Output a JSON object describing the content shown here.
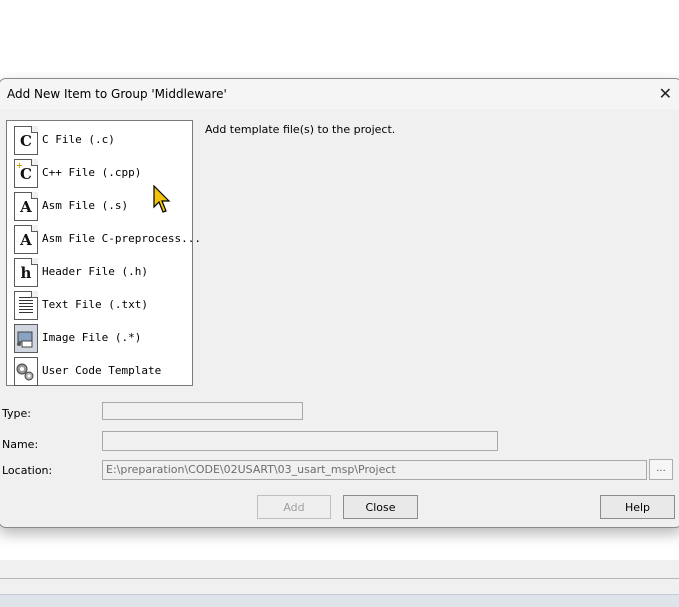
{
  "dialog": {
    "title": "Add New Item to Group 'Middleware'",
    "description": "Add template file(s) to the project.",
    "file_types": [
      {
        "label": "C File (.c)",
        "icon": "c-file-icon",
        "glyph": "C"
      },
      {
        "label": "C++ File (.cpp)",
        "icon": "cpp-file-icon",
        "glyph": "C"
      },
      {
        "label": "Asm File (.s)",
        "icon": "asm-file-icon",
        "glyph": "A"
      },
      {
        "label": "Asm File C-preprocess...",
        "icon": "asm-preprocess-file-icon",
        "glyph": "A"
      },
      {
        "label": "Header File (.h)",
        "icon": "header-file-icon",
        "glyph": "h"
      },
      {
        "label": "Text File (.txt)",
        "icon": "text-file-icon",
        "glyph": ""
      },
      {
        "label": "Image File (.*)",
        "icon": "image-file-icon",
        "glyph": ""
      },
      {
        "label": "User Code Template",
        "icon": "user-code-template-icon",
        "glyph": ""
      }
    ],
    "type_label": "Type:",
    "type_value": "",
    "name_label": "Name:",
    "name_value": "",
    "location_label": "Location:",
    "location_value": "E:\\preparation\\CODE\\02USART\\03_usart_msp\\Project",
    "browse_label": "...",
    "buttons": {
      "add": "Add",
      "close": "Close",
      "help": "Help"
    },
    "close_glyph": "✕"
  }
}
